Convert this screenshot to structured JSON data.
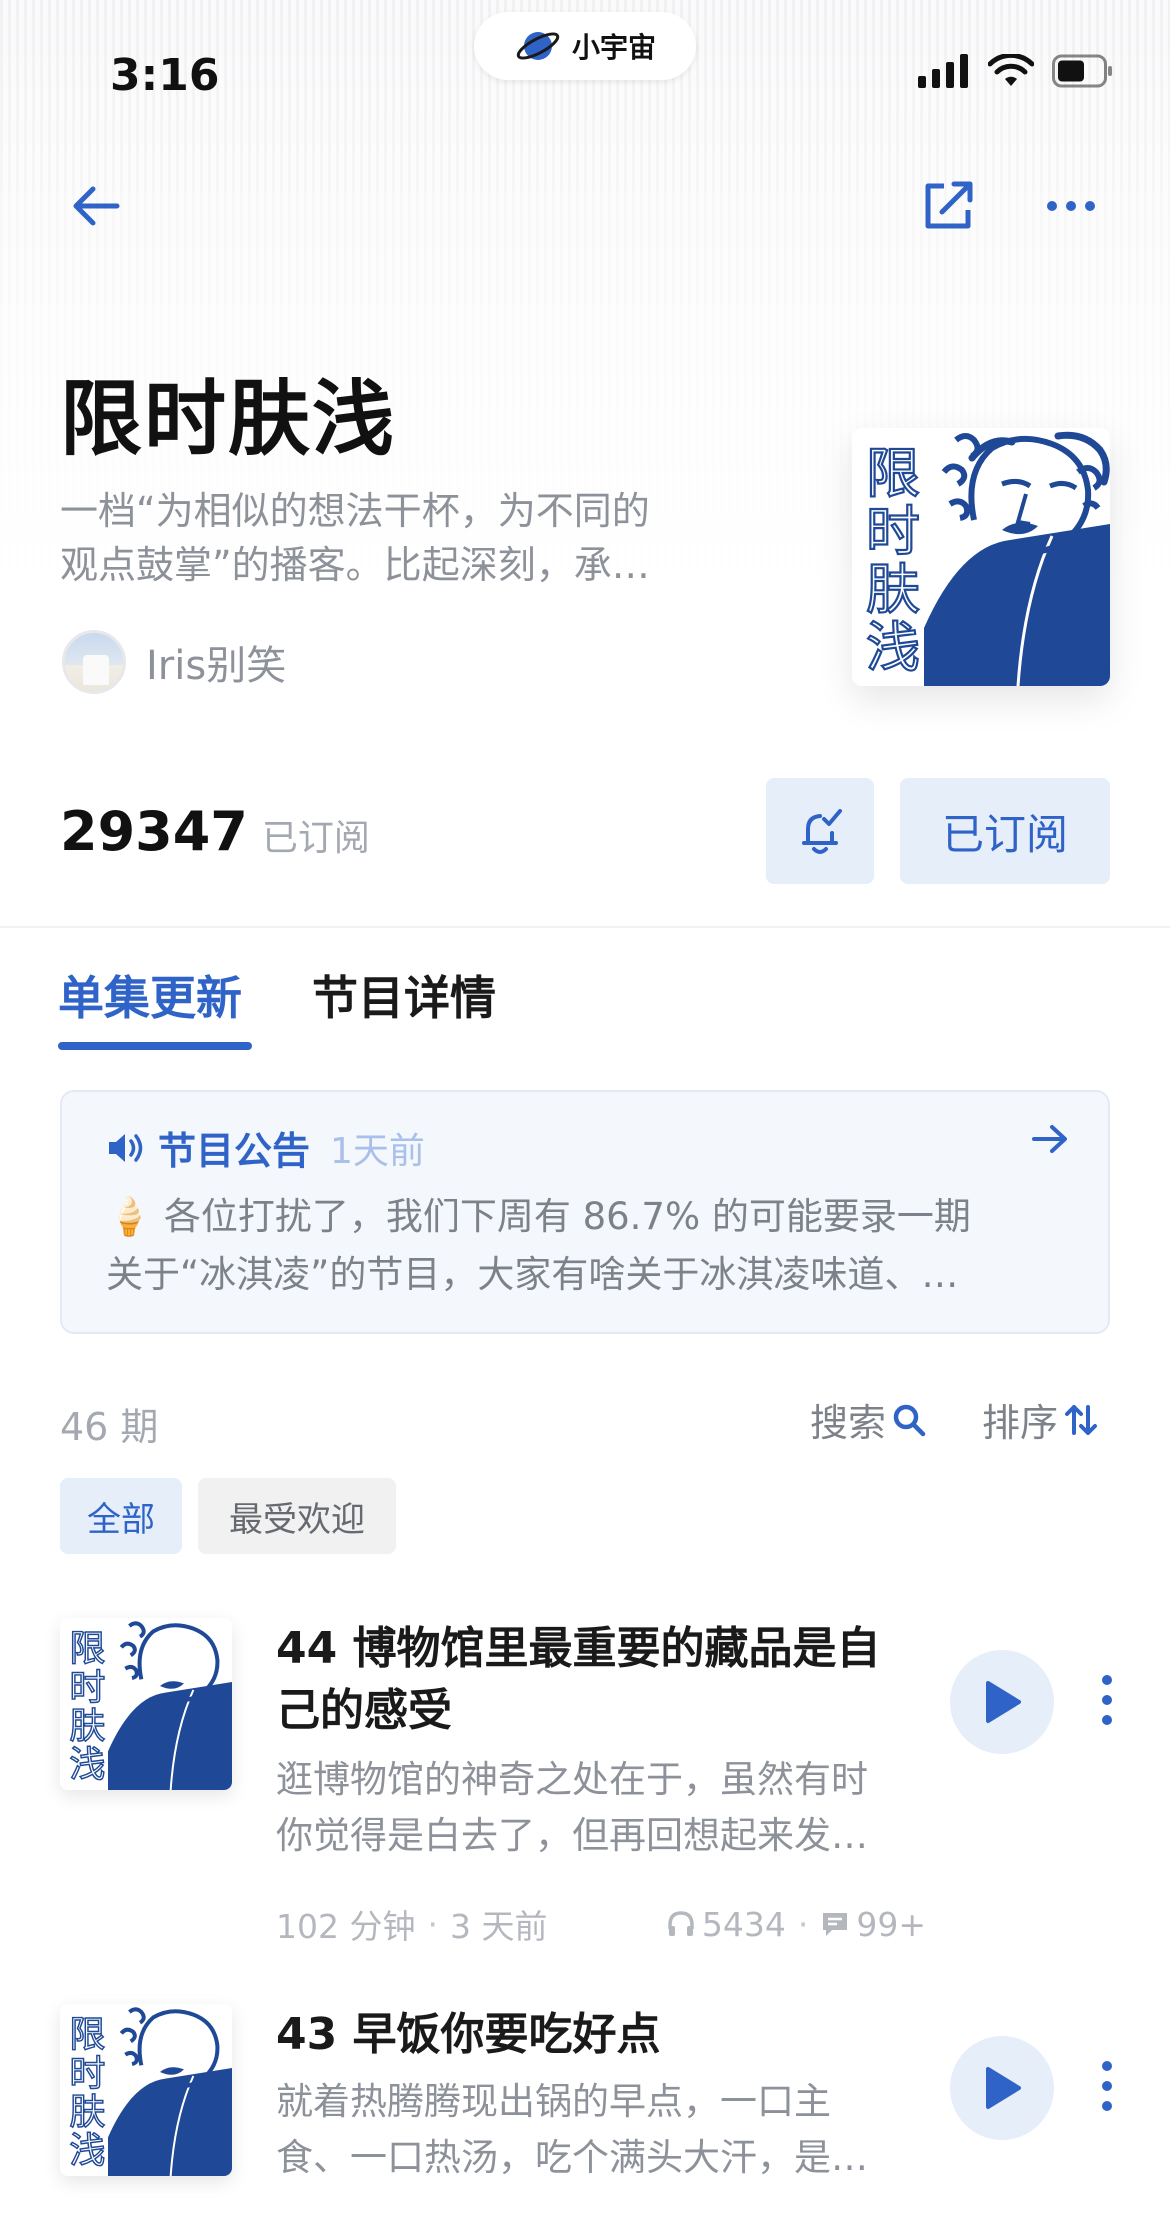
{
  "status_bar": {
    "time": "3:16",
    "pill_label": "小宇宙"
  },
  "podcast": {
    "title": "限时肤浅",
    "description_line1": "一档“为相似的想法干杯，为不同的",
    "description_line2": "观点鼓掌”的播客。比起深刻，承…",
    "author": "Iris别笑",
    "cover_text": "限时肤浅",
    "subscriber_count": "29347",
    "subscriber_label": "已订阅",
    "subscribed_button": "已订阅"
  },
  "tabs": [
    {
      "label": "单集更新",
      "active": true
    },
    {
      "label": "节目详情",
      "active": false
    }
  ],
  "announcement": {
    "title": "节目公告",
    "time": "1天前",
    "line1": "🍦 各位打扰了，我们下周有 86.7% 的可能要录一期",
    "line2": "关于“冰淇凌”的节目，大家有啥关于冰淇凌味道、…"
  },
  "episodes_header": {
    "count": "46 期",
    "search": "搜索",
    "sort": "排序"
  },
  "filters": [
    {
      "label": "全部",
      "active": true
    },
    {
      "label": "最受欢迎",
      "active": false
    }
  ],
  "episodes": [
    {
      "title_line1": "44 博物馆里最重要的藏品是自",
      "title_line2": "己的感受",
      "desc_line1": "逛博物馆的神奇之处在于，虽然有时",
      "desc_line2": "你觉得是白去了，但再回想起来发…",
      "duration": "102 分钟",
      "date": "3 天前",
      "plays": "5434",
      "comments": "99+"
    },
    {
      "title_line1": "43 早饭你要吃好点",
      "desc_line1": "就着热腾腾现出锅的早点，一口主",
      "desc_line2": "食、一口热汤，吃个满头大汗，是…"
    }
  ],
  "colors": {
    "accent": "#2f63c7",
    "accent_light": "#e6eefa",
    "cover_blue": "#1f4996"
  }
}
